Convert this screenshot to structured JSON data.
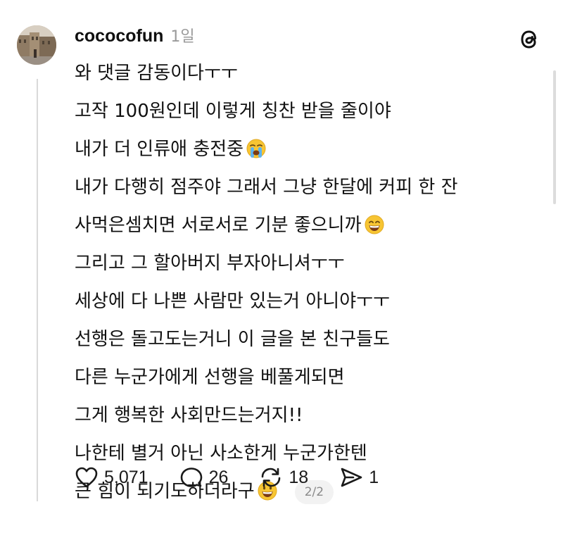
{
  "post": {
    "username": "cococofun",
    "timestamp": "1일",
    "lines": [
      "와 댓글 감동이다ㅜㅜ",
      "고작 100원인데 이렇게 칭찬 받을 줄이야",
      "내가 더 인류애 충전중",
      "내가 다행히 점주야 그래서 그냥 한달에 커피 한 잔",
      "사먹은셈치면 서로서로 기분 좋으니까",
      "그리고 그 할아버지 부자아니셔ㅜㅜ",
      "세상에 다 나쁜 사람만 있는거 아니야ㅜㅜ",
      "선행은 돌고도는거니 이 글을 본 친구들도",
      "다른 누군가에게 선행을 베풀게되면",
      "그게 행복한 사회만드는거지!!",
      "나한테 별거 아닌 사소한게 누군가한텐",
      "큰 힘이 되기도하더라구"
    ],
    "page_indicator": "2/2"
  },
  "emojis": {
    "line3": "loudly-crying-face-icon",
    "line5": "grinning-face-icon",
    "line12": "grinning-face-icon"
  },
  "actions": {
    "likes": "5,071",
    "replies": "26",
    "reposts": "18",
    "shares": "1"
  },
  "colors": {
    "text": "#111111",
    "secondary": "#9a9a9a",
    "thread_line": "#d9d9d9",
    "badge_bg": "#f2f2f2"
  }
}
